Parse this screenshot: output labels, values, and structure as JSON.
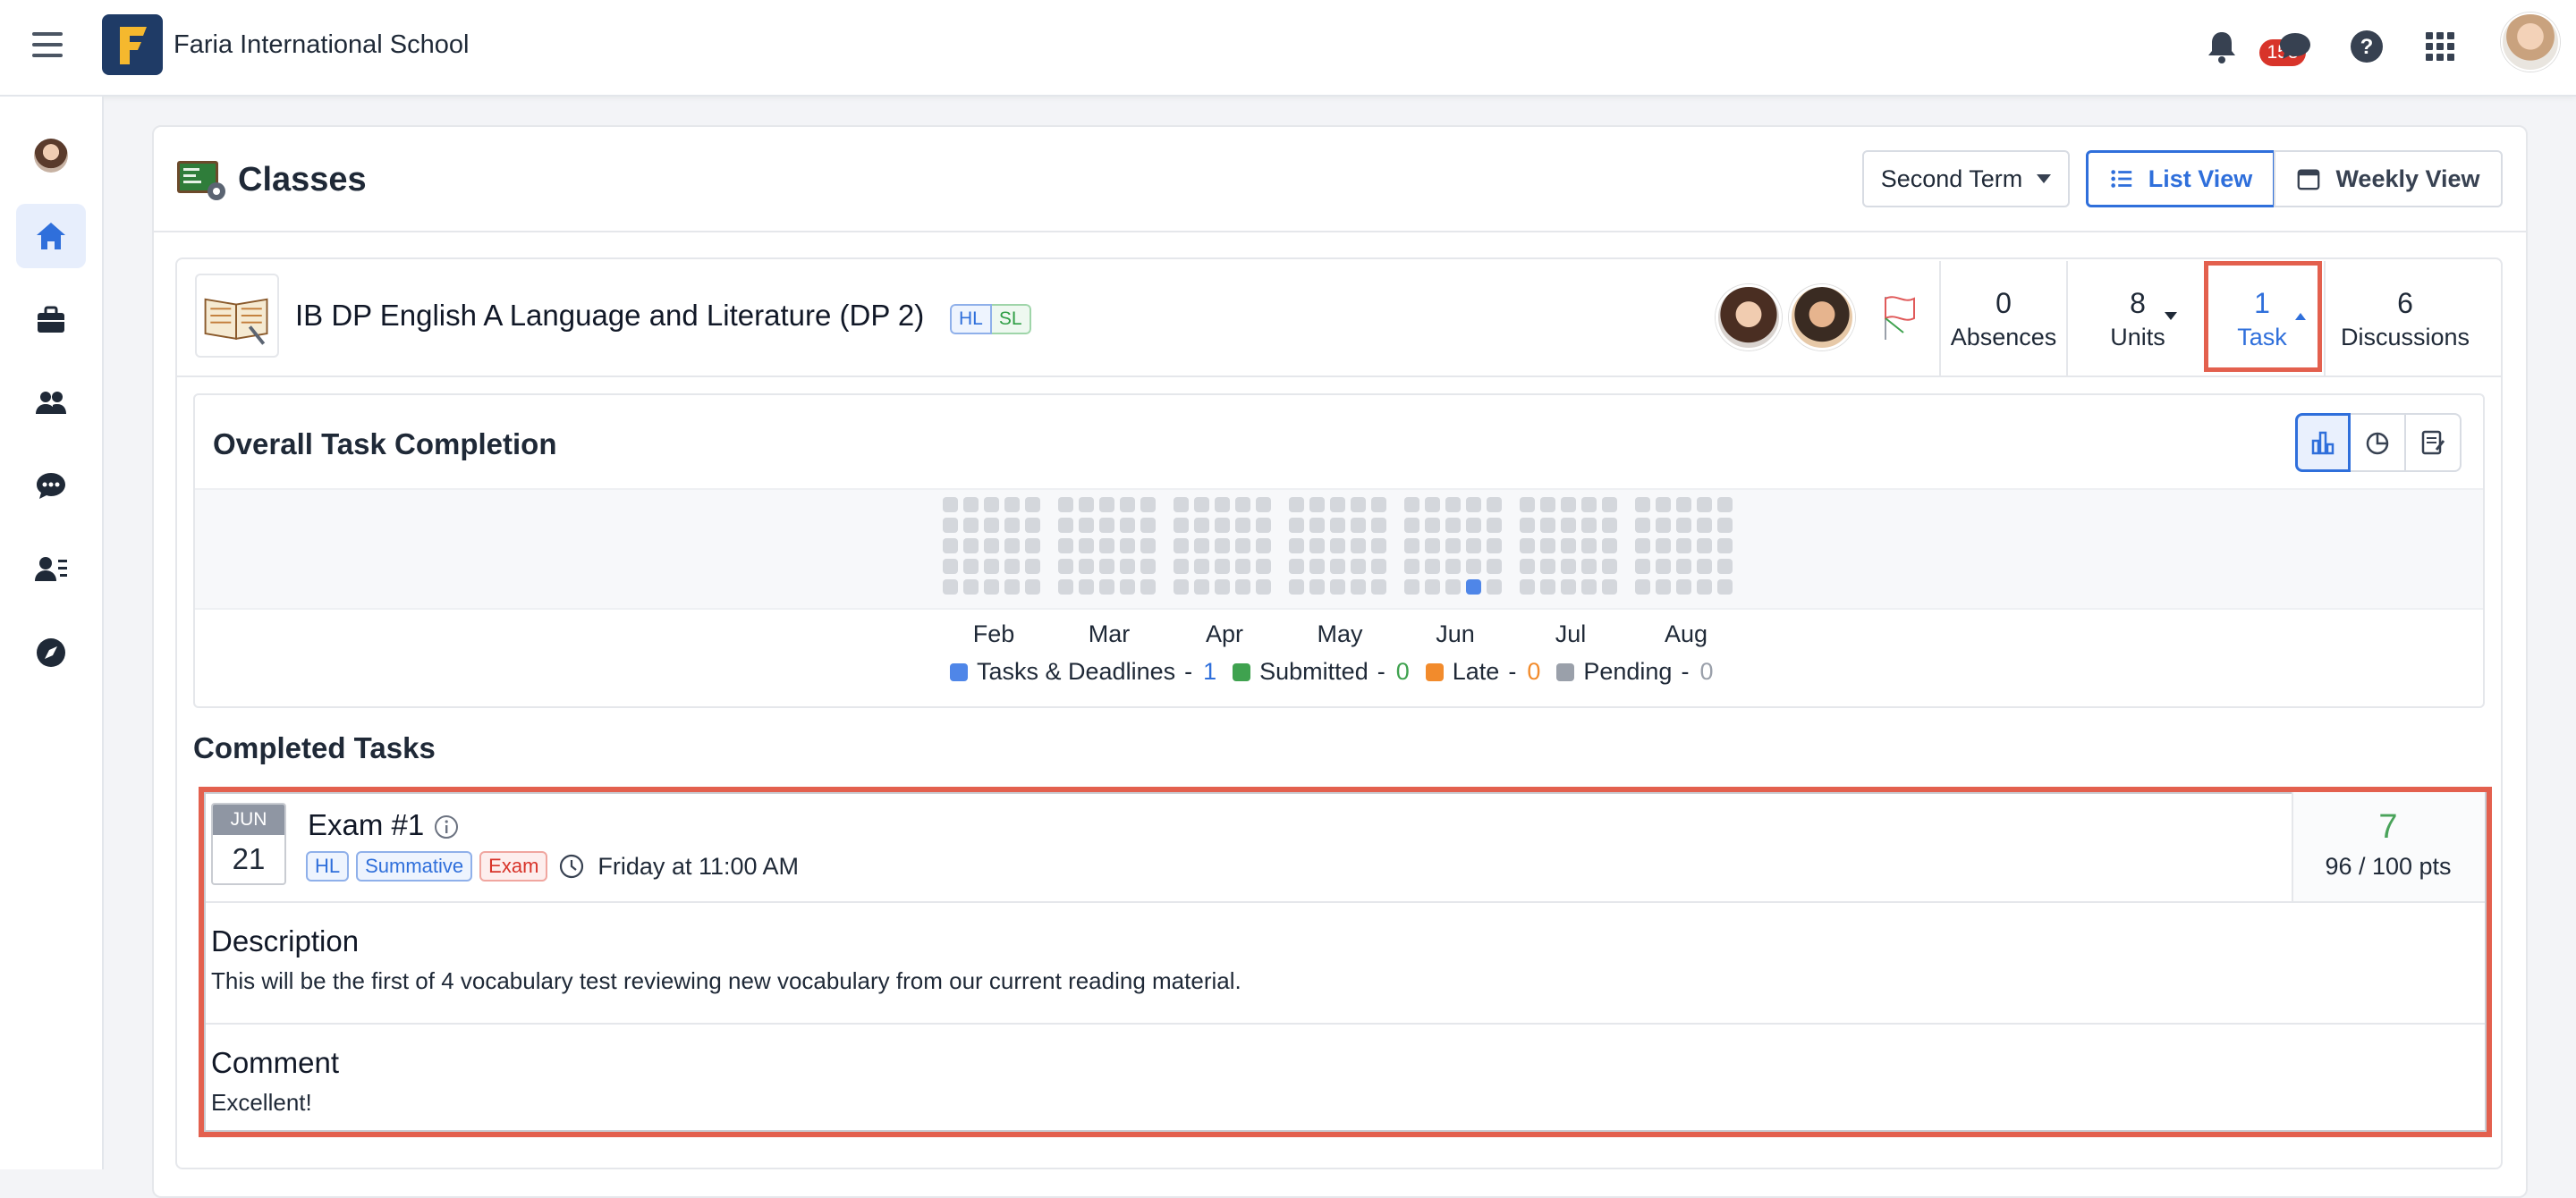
{
  "header": {
    "school_name": "Faria International School",
    "notification_count": "158"
  },
  "sidebar": {
    "items": [
      {
        "name": "profile"
      },
      {
        "name": "home"
      },
      {
        "name": "portfolio"
      },
      {
        "name": "people"
      },
      {
        "name": "messages"
      },
      {
        "name": "directory"
      },
      {
        "name": "explore"
      }
    ]
  },
  "classes": {
    "title": "Classes",
    "term_label": "Second Term",
    "list_view_label": "List View",
    "weekly_view_label": "Weekly View"
  },
  "class_card": {
    "title": "IB DP English A Language and Literature (DP 2)",
    "level_hl": "HL",
    "level_sl": "SL",
    "stats": {
      "absences_value": "0",
      "absences_label": "Absences",
      "units_value": "8",
      "units_label": "Units",
      "task_value": "1",
      "task_label": "Task",
      "discussions_value": "6",
      "discussions_label": "Discussions"
    }
  },
  "completion": {
    "title": "Overall Task Completion",
    "months": [
      "Feb",
      "Mar",
      "Apr",
      "May",
      "Jun",
      "Jul",
      "Aug"
    ],
    "legend": [
      {
        "label": "Tasks & Deadlines",
        "count": "1",
        "color": "#4f86e8"
      },
      {
        "label": "Submitted",
        "count": "0",
        "color": "#3fa24f"
      },
      {
        "label": "Late",
        "count": "0",
        "color": "#f28b2c"
      },
      {
        "label": "Pending",
        "count": "0",
        "color": "#9aa0aa"
      }
    ],
    "highlight": {
      "month_index": 4,
      "row": 4,
      "col": 3
    }
  },
  "completed_tasks": {
    "title": "Completed Tasks",
    "task": {
      "month": "JUN",
      "day": "21",
      "title": "Exam #1",
      "tags": [
        "HL",
        "Summative",
        "Exam"
      ],
      "due": "Friday at 11:00 AM",
      "score": "7",
      "points": "96 / 100 pts",
      "description_title": "Description",
      "description": "This will be the first of 4 vocabulary test reviewing new vocabulary from our current reading material.",
      "comment_title": "Comment",
      "comment": "Excellent!"
    }
  }
}
